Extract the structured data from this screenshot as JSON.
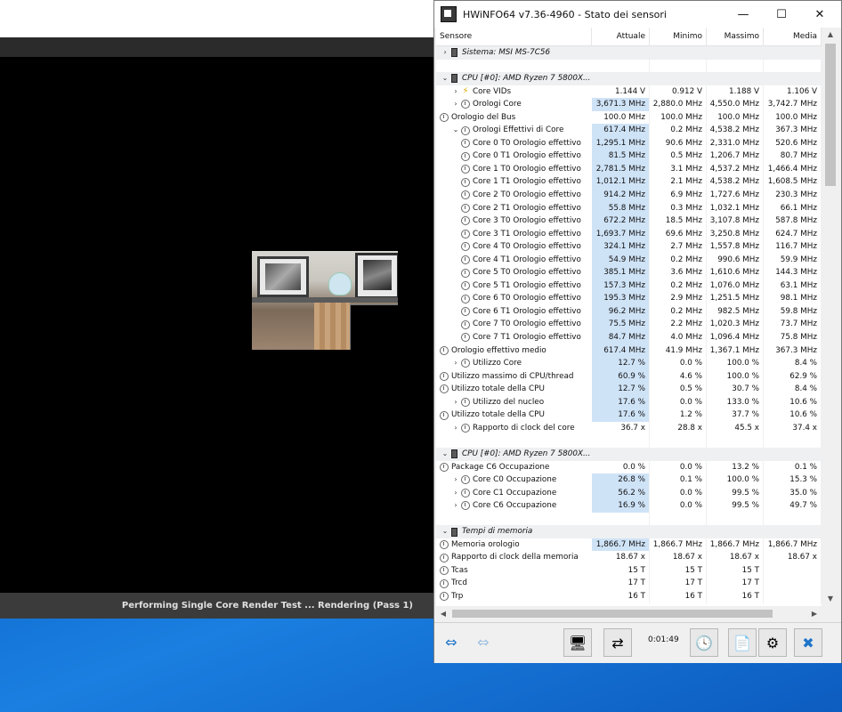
{
  "render": {
    "status": "Performing Single Core Render Test ... Rendering (Pass 1)"
  },
  "window": {
    "title": "HWiNFO64 v7.36-4960 - Stato dei sensori",
    "minimize": "—",
    "maximize": "☐",
    "close": "✕"
  },
  "columns": [
    "Sensore",
    "Attuale",
    "Minimo",
    "Massimo",
    "Media"
  ],
  "rows": [
    {
      "kind": "group",
      "exp": "›",
      "icon": "chip",
      "label": "Sistema: MSI MS-7C56",
      "v": [
        "",
        "",
        "",
        ""
      ]
    },
    {
      "kind": "blank",
      "label": "",
      "v": [
        "",
        "",
        "",
        ""
      ]
    },
    {
      "kind": "group",
      "exp": "⌄",
      "icon": "chip",
      "label": "CPU [#0]: AMD Ryzen 7 5800X...",
      "v": [
        "",
        "",
        "",
        ""
      ]
    },
    {
      "kind": "item",
      "indent": 1,
      "exp": "›",
      "icon": "bolt",
      "label": "Core VIDs",
      "v": [
        "1.144 V",
        "0.912 V",
        "1.188 V",
        "1.106 V"
      ]
    },
    {
      "kind": "item",
      "indent": 1,
      "exp": "›",
      "icon": "clock",
      "label": "Orologi Core",
      "v": [
        "3,671.3 MHz",
        "2,880.0 MHz",
        "4,550.0 MHz",
        "3,742.7 MHz"
      ],
      "hl": true
    },
    {
      "kind": "item",
      "indent": 0,
      "exp": "",
      "icon": "clock",
      "label": "Orologio del Bus",
      "v": [
        "100.0 MHz",
        "100.0 MHz",
        "100.0 MHz",
        "100.0 MHz"
      ]
    },
    {
      "kind": "item",
      "indent": 1,
      "exp": "⌄",
      "icon": "clock",
      "label": "Orologi Effettivi di Core",
      "v": [
        "617.4 MHz",
        "0.2 MHz",
        "4,538.2 MHz",
        "367.3 MHz"
      ],
      "hl": true
    },
    {
      "kind": "item",
      "indent": 2,
      "exp": "",
      "icon": "clock",
      "label": "Core 0 T0 Orologio effettivo",
      "v": [
        "1,295.1 MHz",
        "90.6 MHz",
        "2,331.0 MHz",
        "520.6 MHz"
      ],
      "hl": true
    },
    {
      "kind": "item",
      "indent": 2,
      "exp": "",
      "icon": "clock",
      "label": "Core 0 T1 Orologio effettivo",
      "v": [
        "81.5 MHz",
        "0.5 MHz",
        "1,206.7 MHz",
        "80.7 MHz"
      ],
      "hl": true
    },
    {
      "kind": "item",
      "indent": 2,
      "exp": "",
      "icon": "clock",
      "label": "Core 1 T0 Orologio effettivo",
      "v": [
        "2,781.5 MHz",
        "3.1 MHz",
        "4,537.2 MHz",
        "1,466.4 MHz"
      ],
      "hl": true
    },
    {
      "kind": "item",
      "indent": 2,
      "exp": "",
      "icon": "clock",
      "label": "Core 1 T1 Orologio effettivo",
      "v": [
        "1,012.1 MHz",
        "2.1 MHz",
        "4,538.2 MHz",
        "1,608.5 MHz"
      ],
      "hl": true
    },
    {
      "kind": "item",
      "indent": 2,
      "exp": "",
      "icon": "clock",
      "label": "Core 2 T0 Orologio effettivo",
      "v": [
        "914.2 MHz",
        "6.9 MHz",
        "1,727.6 MHz",
        "230.3 MHz"
      ],
      "hl": true
    },
    {
      "kind": "item",
      "indent": 2,
      "exp": "",
      "icon": "clock",
      "label": "Core 2 T1 Orologio effettivo",
      "v": [
        "55.8 MHz",
        "0.3 MHz",
        "1,032.1 MHz",
        "66.1 MHz"
      ],
      "hl": true
    },
    {
      "kind": "item",
      "indent": 2,
      "exp": "",
      "icon": "clock",
      "label": "Core 3 T0 Orologio effettivo",
      "v": [
        "672.2 MHz",
        "18.5 MHz",
        "3,107.8 MHz",
        "587.8 MHz"
      ],
      "hl": true
    },
    {
      "kind": "item",
      "indent": 2,
      "exp": "",
      "icon": "clock",
      "label": "Core 3 T1 Orologio effettivo",
      "v": [
        "1,693.7 MHz",
        "69.6 MHz",
        "3,250.8 MHz",
        "624.7 MHz"
      ],
      "hl": true
    },
    {
      "kind": "item",
      "indent": 2,
      "exp": "",
      "icon": "clock",
      "label": "Core 4 T0 Orologio effettivo",
      "v": [
        "324.1 MHz",
        "2.7 MHz",
        "1,557.8 MHz",
        "116.7 MHz"
      ],
      "hl": true
    },
    {
      "kind": "item",
      "indent": 2,
      "exp": "",
      "icon": "clock",
      "label": "Core 4 T1 Orologio effettivo",
      "v": [
        "54.9 MHz",
        "0.2 MHz",
        "990.6 MHz",
        "59.9 MHz"
      ],
      "hl": true
    },
    {
      "kind": "item",
      "indent": 2,
      "exp": "",
      "icon": "clock",
      "label": "Core 5 T0 Orologio effettivo",
      "v": [
        "385.1 MHz",
        "3.6 MHz",
        "1,610.6 MHz",
        "144.3 MHz"
      ],
      "hl": true
    },
    {
      "kind": "item",
      "indent": 2,
      "exp": "",
      "icon": "clock",
      "label": "Core 5 T1 Orologio effettivo",
      "v": [
        "157.3 MHz",
        "0.2 MHz",
        "1,076.0 MHz",
        "63.1 MHz"
      ],
      "hl": true
    },
    {
      "kind": "item",
      "indent": 2,
      "exp": "",
      "icon": "clock",
      "label": "Core 6 T0 Orologio effettivo",
      "v": [
        "195.3 MHz",
        "2.9 MHz",
        "1,251.5 MHz",
        "98.1 MHz"
      ],
      "hl": true
    },
    {
      "kind": "item",
      "indent": 2,
      "exp": "",
      "icon": "clock",
      "label": "Core 6 T1 Orologio effettivo",
      "v": [
        "96.2 MHz",
        "0.2 MHz",
        "982.5 MHz",
        "59.8 MHz"
      ],
      "hl": true
    },
    {
      "kind": "item",
      "indent": 2,
      "exp": "",
      "icon": "clock",
      "label": "Core 7 T0 Orologio effettivo",
      "v": [
        "75.5 MHz",
        "2.2 MHz",
        "1,020.3 MHz",
        "73.7 MHz"
      ],
      "hl": true
    },
    {
      "kind": "item",
      "indent": 2,
      "exp": "",
      "icon": "clock",
      "label": "Core 7 T1 Orologio effettivo",
      "v": [
        "84.7 MHz",
        "4.0 MHz",
        "1,096.4 MHz",
        "75.8 MHz"
      ],
      "hl": true
    },
    {
      "kind": "item",
      "indent": 0,
      "exp": "",
      "icon": "clock",
      "label": "Orologio effettivo medio",
      "v": [
        "617.4 MHz",
        "41.9 MHz",
        "1,367.1 MHz",
        "367.3 MHz"
      ],
      "hl": true
    },
    {
      "kind": "item",
      "indent": 1,
      "exp": "›",
      "icon": "clock",
      "label": "Utilizzo Core",
      "v": [
        "12.7 %",
        "0.0 %",
        "100.0 %",
        "8.4 %"
      ],
      "hl": true
    },
    {
      "kind": "item",
      "indent": 0,
      "exp": "",
      "icon": "clock",
      "label": "Utilizzo massimo di CPU/thread",
      "v": [
        "60.9 %",
        "4.6 %",
        "100.0 %",
        "62.9 %"
      ],
      "hl": true
    },
    {
      "kind": "item",
      "indent": 0,
      "exp": "",
      "icon": "clock",
      "label": "Utilizzo totale della CPU",
      "v": [
        "12.7 %",
        "0.5 %",
        "30.7 %",
        "8.4 %"
      ],
      "hl": true
    },
    {
      "kind": "item",
      "indent": 1,
      "exp": "›",
      "icon": "clock",
      "label": "Utilizzo del nucleo",
      "v": [
        "17.6 %",
        "0.0 %",
        "133.0 %",
        "10.6 %"
      ],
      "hl": true
    },
    {
      "kind": "item",
      "indent": 0,
      "exp": "",
      "icon": "clock",
      "label": "Utilizzo totale della CPU",
      "v": [
        "17.6 %",
        "1.2 %",
        "37.7 %",
        "10.6 %"
      ],
      "hl": true
    },
    {
      "kind": "item",
      "indent": 1,
      "exp": "›",
      "icon": "clock",
      "label": "Rapporto di clock del core",
      "v": [
        "36.7 x",
        "28.8 x",
        "45.5 x",
        "37.4 x"
      ]
    },
    {
      "kind": "blank",
      "label": "",
      "v": [
        "",
        "",
        "",
        ""
      ]
    },
    {
      "kind": "group",
      "exp": "⌄",
      "icon": "chip",
      "label": "CPU [#0]: AMD Ryzen 7 5800X...",
      "v": [
        "",
        "",
        "",
        ""
      ]
    },
    {
      "kind": "item",
      "indent": 0,
      "exp": "",
      "icon": "clock",
      "label": "Package C6 Occupazione",
      "v": [
        "0.0 %",
        "0.0 %",
        "13.2 %",
        "0.1 %"
      ]
    },
    {
      "kind": "item",
      "indent": 1,
      "exp": "›",
      "icon": "clock",
      "label": "Core C0 Occupazione",
      "v": [
        "26.8 %",
        "0.1 %",
        "100.0 %",
        "15.3 %"
      ],
      "hl": true
    },
    {
      "kind": "item",
      "indent": 1,
      "exp": "›",
      "icon": "clock",
      "label": "Core C1 Occupazione",
      "v": [
        "56.2 %",
        "0.0 %",
        "99.5 %",
        "35.0 %"
      ],
      "hl": true
    },
    {
      "kind": "item",
      "indent": 1,
      "exp": "›",
      "icon": "clock",
      "label": "Core C6 Occupazione",
      "v": [
        "16.9 %",
        "0.0 %",
        "99.5 %",
        "49.7 %"
      ],
      "hl": true
    },
    {
      "kind": "blank",
      "label": "",
      "v": [
        "",
        "",
        "",
        ""
      ]
    },
    {
      "kind": "group",
      "exp": "⌄",
      "icon": "chip",
      "label": "Tempi di memoria",
      "v": [
        "",
        "",
        "",
        ""
      ]
    },
    {
      "kind": "item",
      "indent": 0,
      "exp": "",
      "icon": "clock",
      "label": "Memoria orologio",
      "v": [
        "1,866.7 MHz",
        "1,866.7 MHz",
        "1,866.7 MHz",
        "1,866.7 MHz"
      ],
      "hl": true
    },
    {
      "kind": "item",
      "indent": 0,
      "exp": "",
      "icon": "clock",
      "label": "Rapporto di clock della memoria",
      "v": [
        "18.67 x",
        "18.67 x",
        "18.67 x",
        "18.67 x"
      ]
    },
    {
      "kind": "item",
      "indent": 0,
      "exp": "",
      "icon": "clock",
      "label": "Tcas",
      "v": [
        "15 T",
        "15 T",
        "15 T",
        ""
      ]
    },
    {
      "kind": "item",
      "indent": 0,
      "exp": "",
      "icon": "clock",
      "label": "Trcd",
      "v": [
        "17 T",
        "17 T",
        "17 T",
        ""
      ]
    },
    {
      "kind": "item",
      "indent": 0,
      "exp": "",
      "icon": "clock",
      "label": "Trp",
      "v": [
        "16 T",
        "16 T",
        "16 T",
        ""
      ]
    }
  ],
  "toolbar": {
    "timer": "0:01:49",
    "buttons": [
      {
        "name": "expand-columns-button",
        "glyph": "⇔"
      },
      {
        "name": "collapse-columns-button",
        "glyph": "⇔"
      },
      {
        "name": "report-button",
        "glyph": "🖥"
      },
      {
        "name": "network-button",
        "glyph": "⇄"
      },
      {
        "name": "clock-reset-button",
        "glyph": "🕓"
      },
      {
        "name": "log-add-button",
        "glyph": "📄"
      },
      {
        "name": "settings-button",
        "glyph": "⚙"
      },
      {
        "name": "close-sensors-button",
        "glyph": "✖"
      }
    ]
  }
}
